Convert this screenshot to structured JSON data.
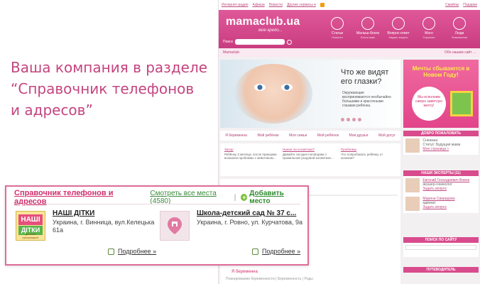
{
  "slide": {
    "caption_line1": "Ваша компания в разделе",
    "caption_line2": "“Справочник телефонов",
    "caption_line3": "и адресов”"
  },
  "site": {
    "topbar": {
      "items": [
        "Интернет-радио",
        "Афиша",
        "Новости",
        "Другие сервисы ▾"
      ],
      "right_links": [
        "Смайлы",
        "Подарки"
      ]
    },
    "logo": "mamaclub.ua",
    "tagline": "моё кредо...",
    "search_label": "Поиск",
    "nav": [
      {
        "label": "Статьи",
        "sub": "Новости"
      },
      {
        "label": "Малыш-блоги",
        "sub": "Блоги мам"
      },
      {
        "label": "Вопрос-ответ",
        "sub": "Задать вопрос"
      },
      {
        "label": "Мого",
        "sub": "Гороскоп"
      },
      {
        "label": "Люди",
        "sub": "Знакомства"
      }
    ],
    "crumb": "Mamaclub",
    "crumb_right": "Обо нашем сайт ...",
    "hero_title_1": "Что же видят",
    "hero_title_2": "его глазки?",
    "hero_text": "Окружающие воспринимаются необычайно большими и красочными глазами ребёнка.",
    "promo_title_1": "Мечты сбываются в",
    "promo_title_2": "Новом Году!",
    "promo_circle": "Мы исполним самую заветную мечту!",
    "tabs": [
      "Я беременна",
      "Мой ребёнок",
      "Моя семья",
      "Мой ребёнок",
      "Мои друзья",
      "Мой досуг"
    ],
    "news": [
      {
        "title": "Запор",
        "text": "Ребёнку 3 месяца, после прикорма возникли проблемы с животиком..."
      },
      {
        "title": "Нужна ли косметика?",
        "text": "Давайте сегодня поговорим о правильной уходовой косметике..."
      },
      {
        "title": "Проблемы",
        "text": "Что попробовать ребёнку от коликов?"
      }
    ],
    "sidebar": {
      "welcome": "ДОБРО ПОЖАЛОВАТЬ",
      "user_name": "Снежана",
      "user_status": "Статус: Будущая мама",
      "user_link": "Моя страница »",
      "experts": "НАШИ ЭКСПЕРТЫ (11)",
      "expert1_name": "Евгений Геннадиевич Вовна",
      "expert1_role": "акушер-гинеколог",
      "expert1_link": "Задать вопрос",
      "expert2_name": "Марина Свиридова",
      "expert2_role": "адвокат",
      "expert2_link": "Задать вопрос",
      "search_title": "ПОИСК ПО САЙТУ",
      "guide_title": "ПУТЕВОДИТЕЛЬ"
    },
    "section_title": "Я беременна",
    "section_links": "Планирование беременности  |  Беременность  |  Роды"
  },
  "widget": {
    "title": "Справочник телефонов и адресов",
    "see_all": "Смотреть все места (4580)",
    "separator": "|",
    "add_icon": "+",
    "add_place": "Добавить место",
    "entries": [
      {
        "name": "НАШІ ДІТКИ",
        "address": "Украина, г. Винница, вул.Келецька 61а",
        "more": "Подробнее »",
        "logo_line1": "НАШІ",
        "logo_line2": "ДІТКИ",
        "logo_line3": "дитячий супермаркет"
      },
      {
        "name": "Школа-детский сад № 37 с...",
        "address": "Украина, г. Ровно, ул. Курчатова, 9а",
        "more": "Подробнее »"
      }
    ]
  }
}
